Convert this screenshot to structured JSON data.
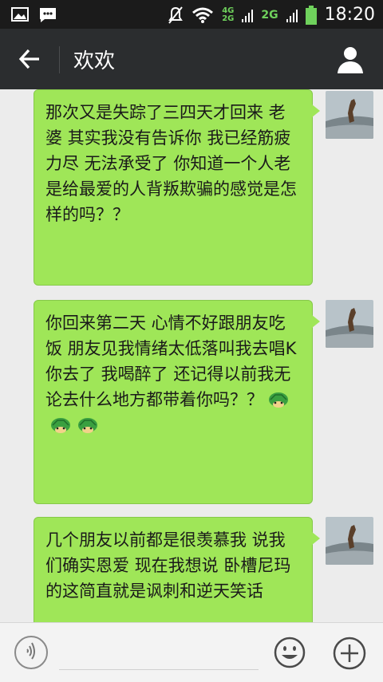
{
  "status_bar": {
    "time": "18:20",
    "network_4g": "4G",
    "network_2g_small": "2G",
    "network_2g": "2G",
    "icons": [
      "image-icon",
      "message-icon",
      "mute-icon",
      "wifi-icon",
      "signal-icon",
      "battery-icon"
    ]
  },
  "header": {
    "title": "欢欢",
    "back_icon": "arrow-left-icon",
    "profile_icon": "person-icon"
  },
  "messages": [
    {
      "text": "那次又是失踪了三四天才回来 老婆 其实我没有告诉你 我已经筋疲力尽 无法承受了 你知道一个人老是给最爱的人背叛欺骗的感觉是怎样的吗？？",
      "sender": "me",
      "emoji": []
    },
    {
      "text": "你回来第二天 心情不好跟朋友吃饭 朋友见我情绪太低落叫我去唱K 你去了 我喝醉了 还记得以前我无论去什么地方都带着你吗？？",
      "sender": "me",
      "emoji": [
        "turtle-emoji",
        "turtle-emoji",
        "turtle-emoji"
      ]
    },
    {
      "text": "几个朋友以前都是很羡慕我 说我们确实恩爱 现在我想说 卧槽尼玛的这简直就是讽刺和逆天笑话",
      "sender": "me",
      "emoji": []
    }
  ],
  "input_bar": {
    "voice_icon": "voice-icon",
    "emoji_icon": "smiley-icon",
    "plus_icon": "plus-icon"
  },
  "colors": {
    "status_bar_bg": "#1b1b1b",
    "title_bar_bg": "#2b2d2f",
    "chat_bg": "#ececec",
    "bubble_green": "#9fe658",
    "signal_green": "#6fd15c"
  }
}
